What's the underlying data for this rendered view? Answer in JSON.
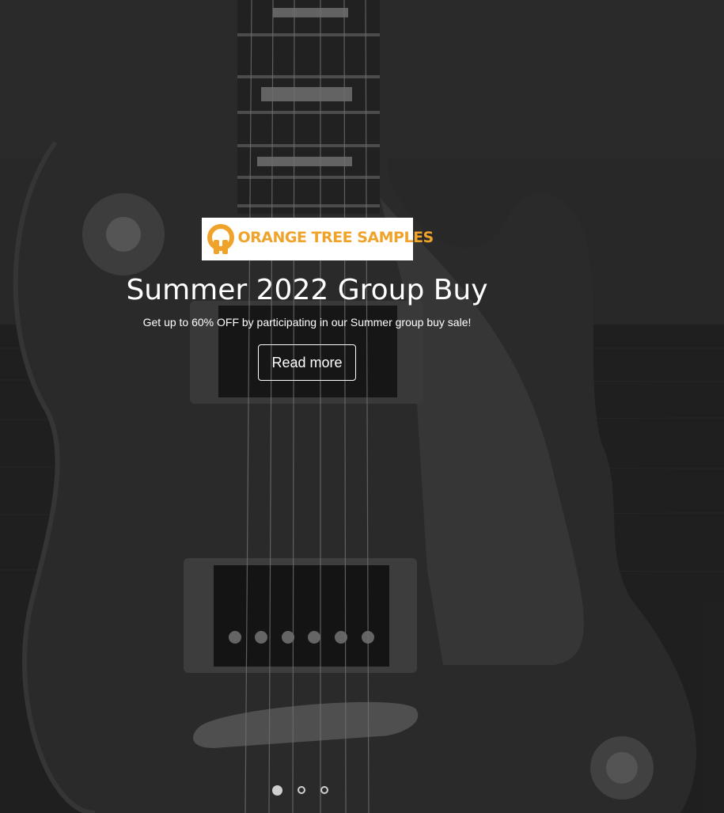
{
  "slide": {
    "logo_text": "ORANGE TREE SAMPLES",
    "title": "Summer 2022 Group Buy",
    "subtitle": "Get up to 60% OFF by participating in our Summer group buy sale!",
    "cta_label": "Read more"
  },
  "carousel": {
    "slide_count": 3,
    "active_index": 0
  },
  "colors": {
    "brand_orange": "#f0a32a",
    "text": "#ffffff"
  }
}
